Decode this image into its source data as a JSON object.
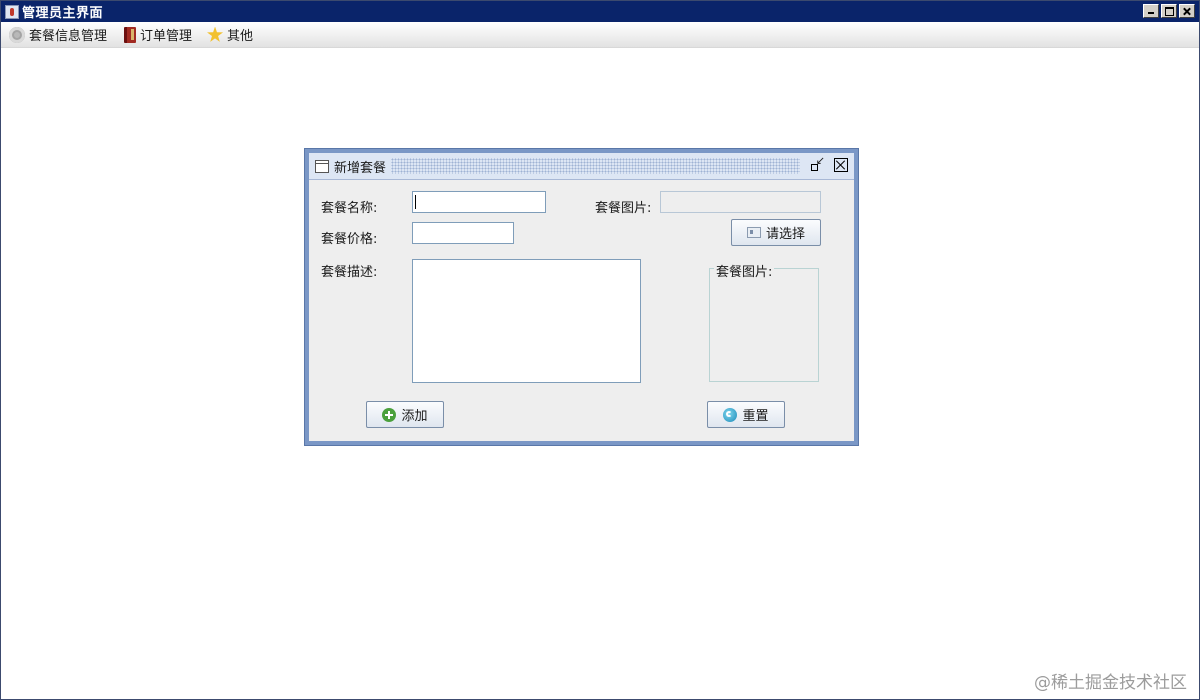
{
  "app": {
    "title": "管理员主界面"
  },
  "menubar": {
    "items": [
      {
        "label": "套餐信息管理",
        "icon": "gear-icon"
      },
      {
        "label": "订单管理",
        "icon": "book-icon"
      },
      {
        "label": "其他",
        "icon": "star-icon"
      }
    ]
  },
  "dialog": {
    "title": "新增套餐",
    "name_label": "套餐名称:",
    "name_value": "",
    "price_label": "套餐价格:",
    "price_value": "",
    "desc_label": "套餐描述:",
    "desc_value": "",
    "image_label": "套餐图片:",
    "image_path_value": "",
    "choose_button": "请选择",
    "preview_legend": "套餐图片:",
    "add_button": "添加",
    "reset_button": "重置"
  },
  "watermark": "@稀土掘金技术社区",
  "colors": {
    "titlebar": "#0a246a",
    "frame_border": "#7a97c6",
    "dialog_bg": "#eeeeee"
  }
}
